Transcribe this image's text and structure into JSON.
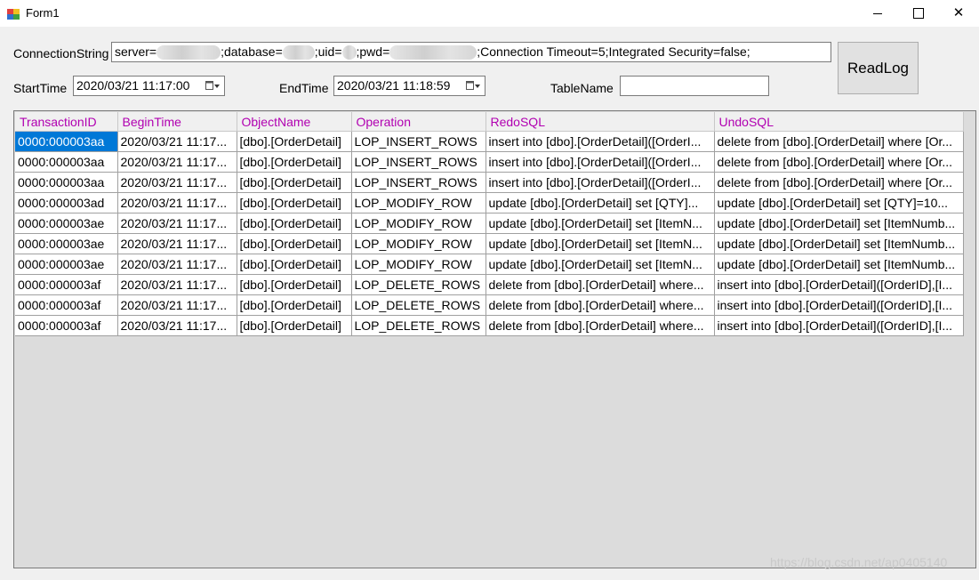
{
  "window": {
    "title": "Form1",
    "icons": {
      "app": "winforms-app-icon",
      "minimize": "minimize-icon",
      "maximize": "maximize-icon",
      "close": "close-icon"
    },
    "close_glyph": "✕"
  },
  "form": {
    "connection_label": "ConnectionString",
    "conn": {
      "server_key": "server=",
      "database_key": ";database=",
      "uid_key": ";uid=",
      "pwd_key": ";pwd=",
      "tail": ";Connection Timeout=5;Integrated Security=false;"
    },
    "start_label": "StartTime",
    "start_value": "2020/03/21 11:17:00",
    "end_label": "EndTime",
    "end_value": "2020/03/21 11:18:59",
    "table_label": "TableName",
    "table_value": "",
    "readlog_label": "ReadLog",
    "calendar_icon": "calendar-dropdown-icon"
  },
  "grid": {
    "header_color": "#b100b1",
    "selection_color": "#0078d7",
    "columns": [
      "TransactionID",
      "BeginTime",
      "ObjectName",
      "Operation",
      "RedoSQL",
      "UndoSQL"
    ],
    "rows": [
      [
        "0000:000003aa",
        "2020/03/21 11:17...",
        "[dbo].[OrderDetail]",
        "LOP_INSERT_ROWS",
        "insert into [dbo].[OrderDetail]([OrderI...",
        "delete from [dbo].[OrderDetail] where [Or..."
      ],
      [
        "0000:000003aa",
        "2020/03/21 11:17...",
        "[dbo].[OrderDetail]",
        "LOP_INSERT_ROWS",
        "insert into [dbo].[OrderDetail]([OrderI...",
        "delete from [dbo].[OrderDetail] where [Or..."
      ],
      [
        "0000:000003aa",
        "2020/03/21 11:17...",
        "[dbo].[OrderDetail]",
        "LOP_INSERT_ROWS",
        "insert into [dbo].[OrderDetail]([OrderI...",
        "delete from [dbo].[OrderDetail] where [Or..."
      ],
      [
        "0000:000003ad",
        "2020/03/21 11:17...",
        "[dbo].[OrderDetail]",
        "LOP_MODIFY_ROW",
        "update [dbo].[OrderDetail] set [QTY]...",
        "update [dbo].[OrderDetail] set [QTY]=10..."
      ],
      [
        "0000:000003ae",
        "2020/03/21 11:17...",
        "[dbo].[OrderDetail]",
        "LOP_MODIFY_ROW",
        "update [dbo].[OrderDetail] set [ItemN...",
        "update [dbo].[OrderDetail] set [ItemNumb..."
      ],
      [
        "0000:000003ae",
        "2020/03/21 11:17...",
        "[dbo].[OrderDetail]",
        "LOP_MODIFY_ROW",
        "update [dbo].[OrderDetail] set [ItemN...",
        "update [dbo].[OrderDetail] set [ItemNumb..."
      ],
      [
        "0000:000003ae",
        "2020/03/21 11:17...",
        "[dbo].[OrderDetail]",
        "LOP_MODIFY_ROW",
        "update [dbo].[OrderDetail] set [ItemN...",
        "update [dbo].[OrderDetail] set [ItemNumb..."
      ],
      [
        "0000:000003af",
        "2020/03/21 11:17...",
        "[dbo].[OrderDetail]",
        "LOP_DELETE_ROWS",
        "delete from [dbo].[OrderDetail] where...",
        "insert into [dbo].[OrderDetail]([OrderID],[I..."
      ],
      [
        "0000:000003af",
        "2020/03/21 11:17...",
        "[dbo].[OrderDetail]",
        "LOP_DELETE_ROWS",
        "delete from [dbo].[OrderDetail] where...",
        "insert into [dbo].[OrderDetail]([OrderID],[I..."
      ],
      [
        "0000:000003af",
        "2020/03/21 11:17...",
        "[dbo].[OrderDetail]",
        "LOP_DELETE_ROWS",
        "delete from [dbo].[OrderDetail] where...",
        "insert into [dbo].[OrderDetail]([OrderID],[I..."
      ]
    ]
  },
  "watermark": "https://blog.csdn.net/ap0405140"
}
